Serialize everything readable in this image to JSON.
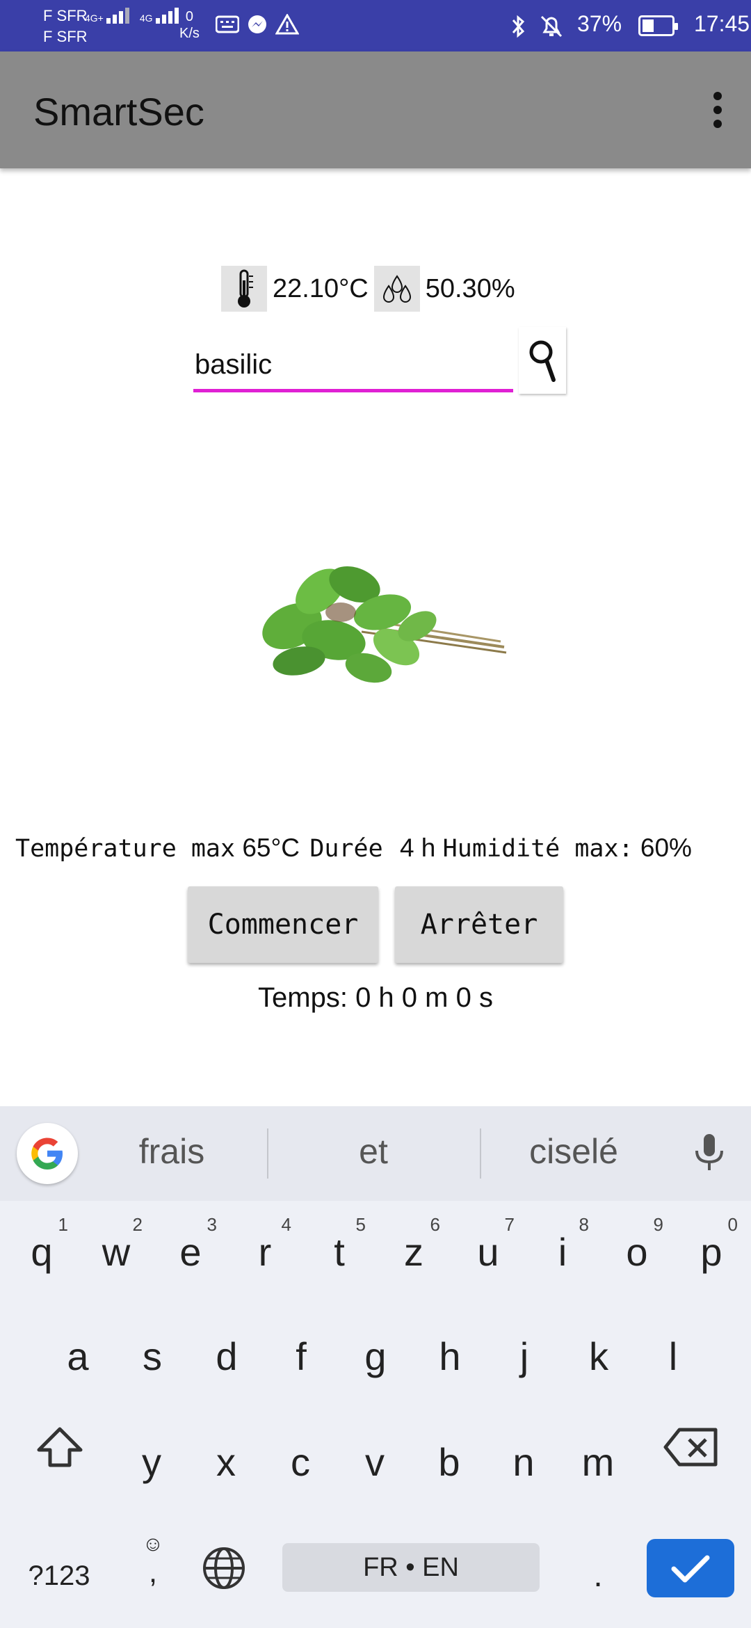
{
  "status_bar": {
    "carrier_1": "F SFR",
    "carrier_2": "F SFR",
    "net_1": "4G+",
    "net_2": "4G",
    "speed_value": "0",
    "speed_unit": "K/s",
    "battery_pct": "37%",
    "time": "17:45",
    "battery_level": 0.37
  },
  "app_bar": {
    "title": "SmartSec",
    "menu_icon": "more-vert-icon"
  },
  "sensors": {
    "temperature": "22.10°C",
    "humidity": "50.30%",
    "temp_icon": "thermometer-icon",
    "humidity_icon": "droplets-icon"
  },
  "search": {
    "value": "basilic",
    "accent_color": "#e020d4",
    "button_icon": "search-icon"
  },
  "plant_image": {
    "icon": "basil-bunch-image"
  },
  "info": {
    "temp_label": "Température max",
    "temp_value": "65°C",
    "duration_label": "Durée",
    "duration_value": "4 h",
    "humidity_label": "Humidité max:",
    "humidity_value": "60%"
  },
  "actions": {
    "start_label": "Commencer",
    "stop_label": "Arrêter"
  },
  "timer": {
    "text": "Temps: 0 h 0 m 0 s"
  },
  "keyboard": {
    "suggestions": [
      "frais",
      "et",
      "ciselé"
    ],
    "row1": [
      {
        "key": "q",
        "hint": "1"
      },
      {
        "key": "w",
        "hint": "2"
      },
      {
        "key": "e",
        "hint": "3"
      },
      {
        "key": "r",
        "hint": "4"
      },
      {
        "key": "t",
        "hint": "5"
      },
      {
        "key": "z",
        "hint": "6"
      },
      {
        "key": "u",
        "hint": "7"
      },
      {
        "key": "i",
        "hint": "8"
      },
      {
        "key": "o",
        "hint": "9"
      },
      {
        "key": "p",
        "hint": "0"
      }
    ],
    "row2": [
      "a",
      "s",
      "d",
      "f",
      "g",
      "h",
      "j",
      "k",
      "l"
    ],
    "row3": [
      "y",
      "x",
      "c",
      "v",
      "b",
      "n",
      "m"
    ],
    "symbols_label": "?123",
    "comma_label": ",",
    "space_label": "FR • EN",
    "period_label": ".",
    "enter_color": "#1d6ed8"
  }
}
